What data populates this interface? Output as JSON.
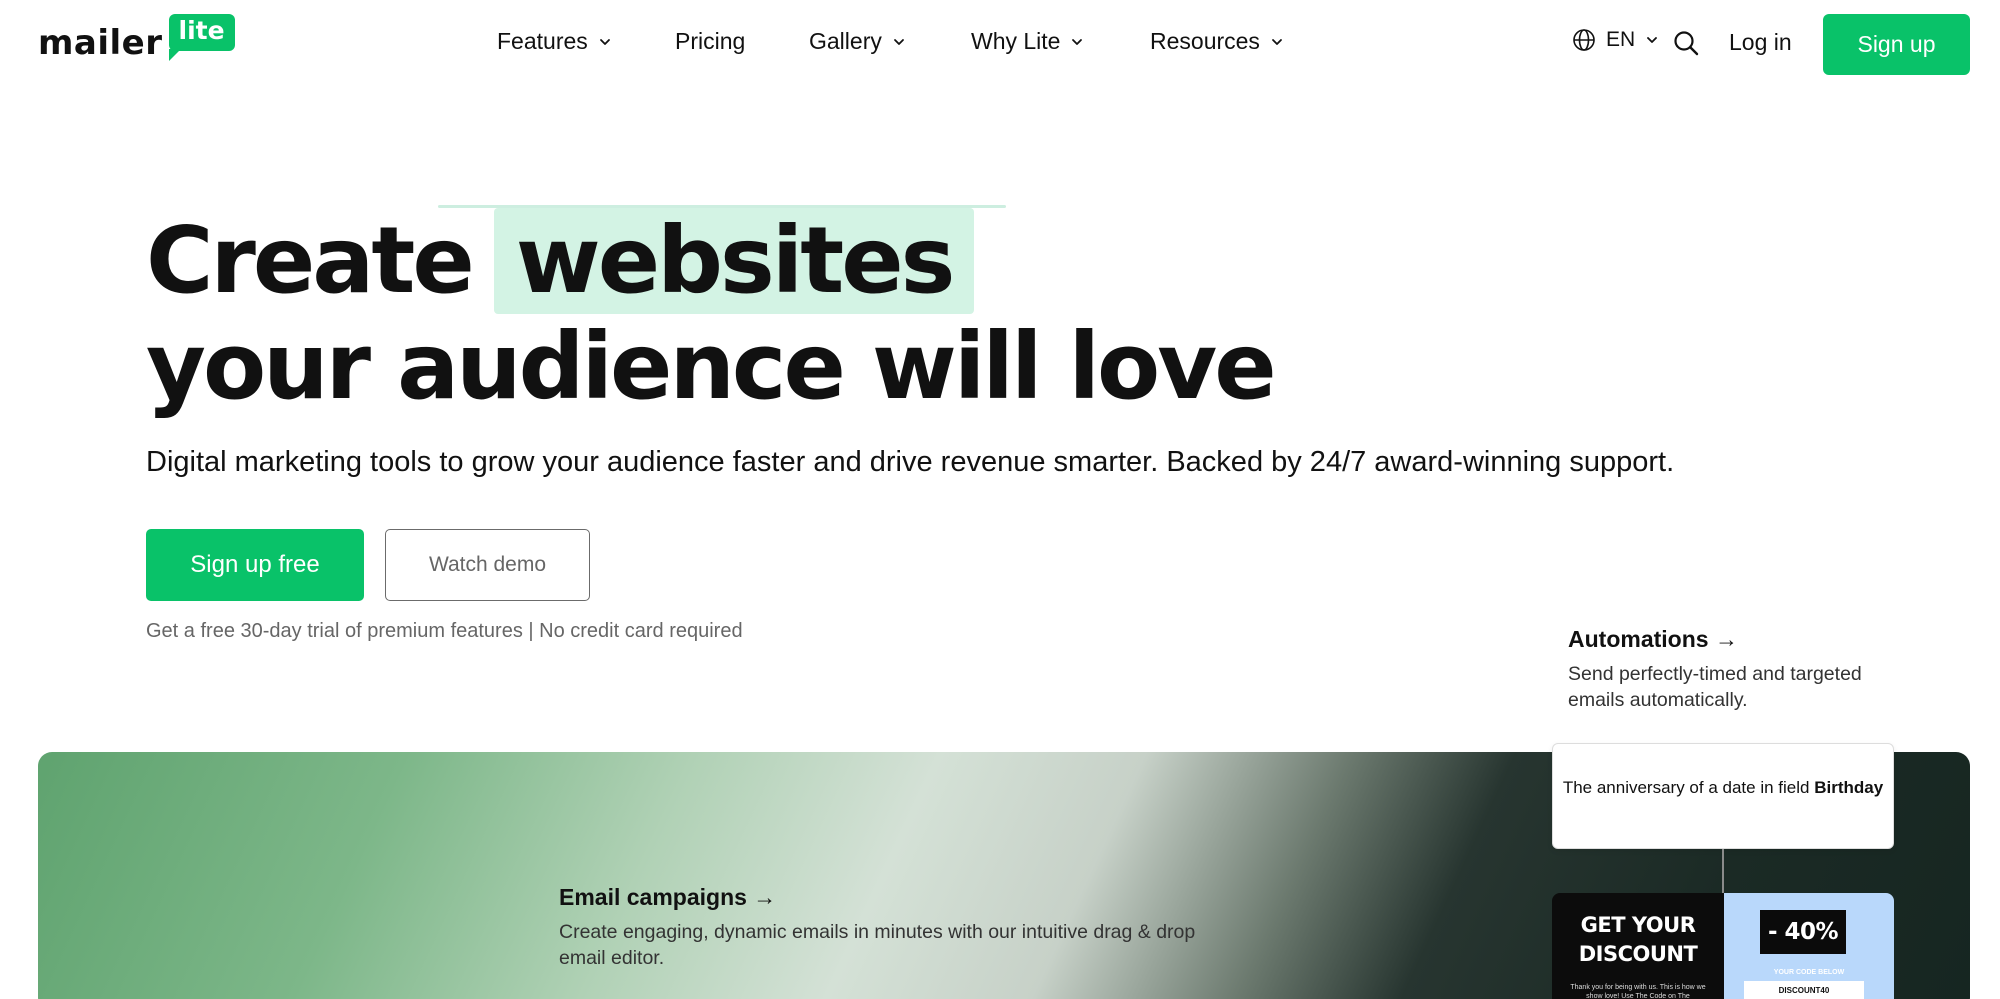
{
  "brand": {
    "word": "mailer",
    "badge": "lite",
    "accent": "#09c269"
  },
  "nav": {
    "items": [
      {
        "label": "Features",
        "has_dropdown": true
      },
      {
        "label": "Pricing",
        "has_dropdown": false
      },
      {
        "label": "Gallery",
        "has_dropdown": true
      },
      {
        "label": "Why Lite",
        "has_dropdown": true
      },
      {
        "label": "Resources",
        "has_dropdown": true
      }
    ],
    "language": "EN",
    "login_label": "Log in",
    "signup_label": "Sign up"
  },
  "hero": {
    "title_prefix": "Create",
    "title_highlight": "websites",
    "title_line2": "your audience will love",
    "subtitle": "Digital marketing tools to grow your audience faster and drive revenue smarter. Backed by 24/7 award-winning support.",
    "primary_cta": "Sign up free",
    "secondary_cta": "Watch demo",
    "note": "Get a free 30-day trial of premium features | No credit card required"
  },
  "features": {
    "automations": {
      "title": "Automations →",
      "description": "Send perfectly-timed and targeted emails automatically.",
      "trigger_text": "The anniversary of a date in field",
      "trigger_field": "Birthday"
    },
    "email_campaigns": {
      "title": "Email campaigns →",
      "description": "Create engaging, dynamic emails in minutes with our intuitive drag & drop email editor."
    }
  },
  "promo_preview": {
    "heading_line1": "GET YOUR",
    "heading_line2": "DISCOUNT",
    "body": "Thank you for being with us. This is how we show love! Use The Code on The",
    "discount": "- 40%",
    "code_label": "YOUR CODE BELOW",
    "code": "DISCOUNT40"
  }
}
